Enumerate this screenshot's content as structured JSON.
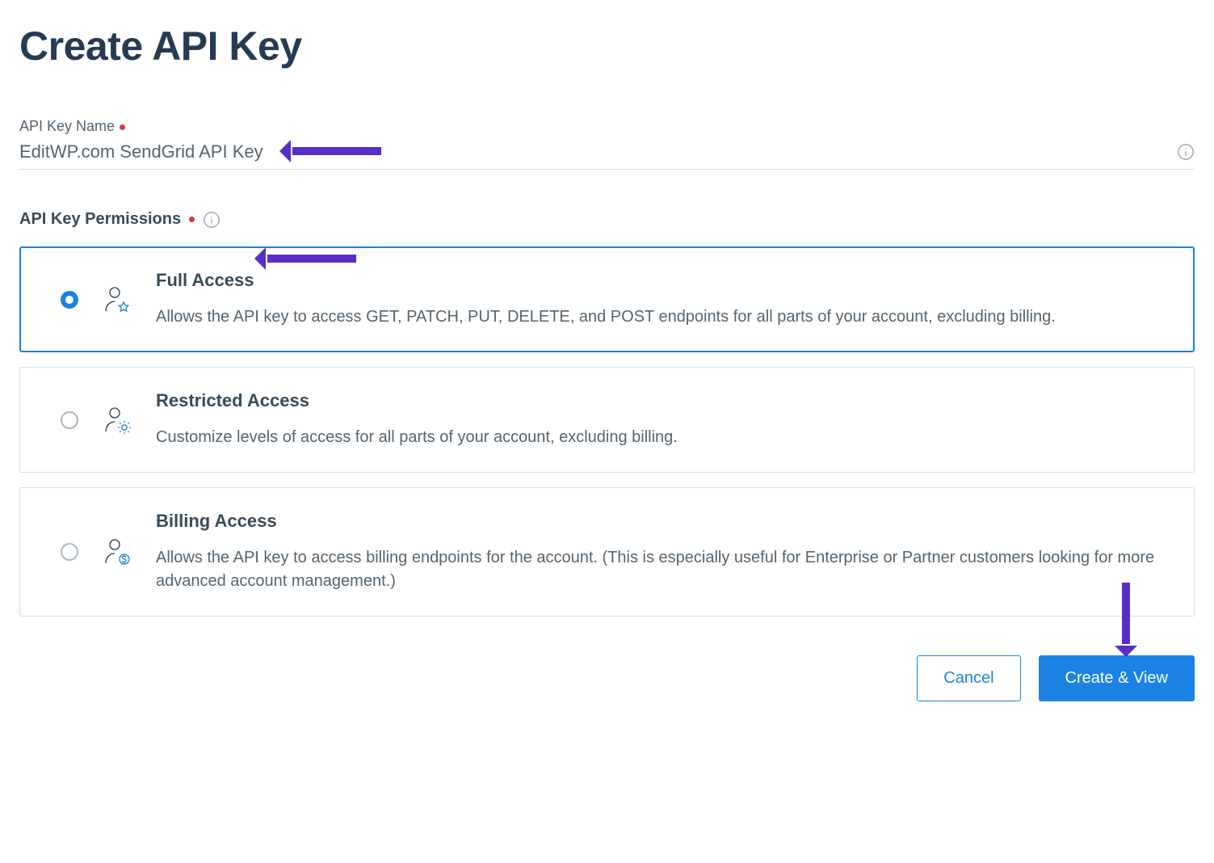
{
  "page": {
    "title": "Create API Key"
  },
  "form": {
    "name_label": "API Key Name",
    "name_value": "EditWP.com SendGrid API Key"
  },
  "permissions": {
    "section_label": "API Key Permissions",
    "options": [
      {
        "title": "Full Access",
        "description": "Allows the API key to access GET, PATCH, PUT, DELETE, and POST endpoints for all parts of your account, excluding billing.",
        "selected": true
      },
      {
        "title": "Restricted Access",
        "description": "Customize levels of access for all parts of your account, excluding billing.",
        "selected": false
      },
      {
        "title": "Billing Access",
        "description": "Allows the API key to access billing endpoints for the account. (This is especially useful for Enterprise or Partner customers looking for more advanced account management.)",
        "selected": false
      }
    ]
  },
  "actions": {
    "cancel": "Cancel",
    "create": "Create & View"
  }
}
